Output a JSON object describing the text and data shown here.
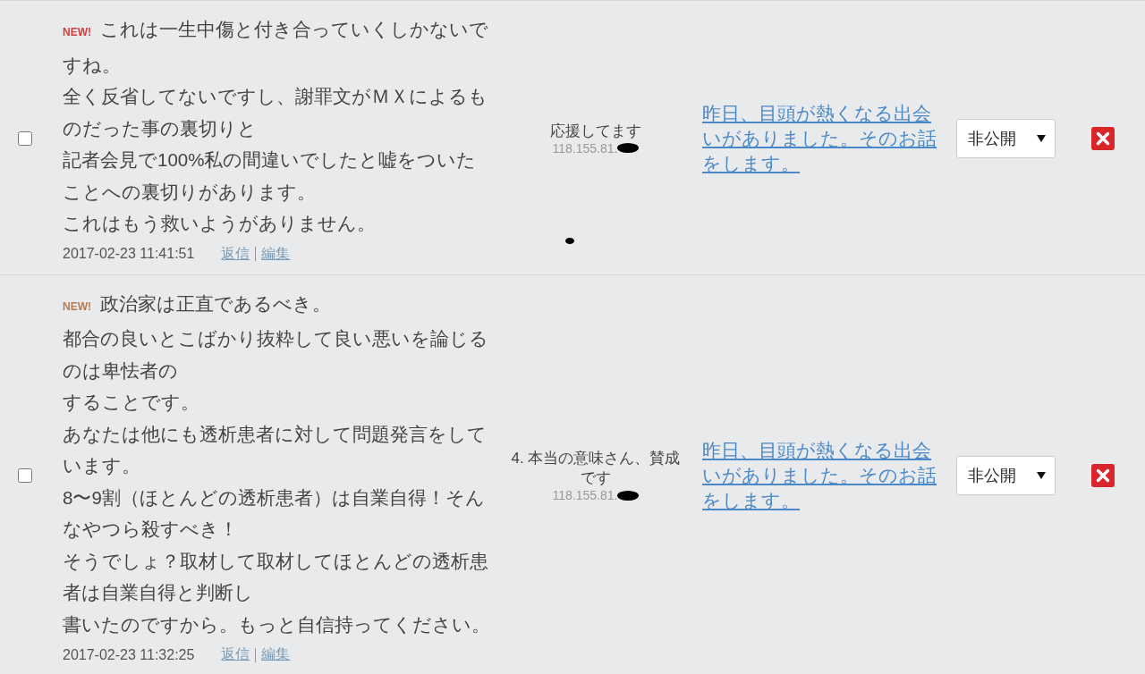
{
  "comments": [
    {
      "checked": false,
      "badge": {
        "label": "NEW!",
        "color": "#d83a3a"
      },
      "lines": [
        "これは一生中傷と付き合っていくしかないで",
        "すね。",
        "全く反省してないですし、謝罪文がＭＸによるも",
        "のだった事の裏切りと",
        "記者会見で100%私の間違いでしたと嘘をついた",
        "ことへの裏切りがあります。",
        "これはもう救いようがありません。"
      ],
      "date": "2017-02-23 11:41:51",
      "actions": [
        "返信",
        "編集"
      ],
      "author": "応援してます",
      "ip": "118.155.81.",
      "post_link": "昨日、目頭が熱くなる出会いがありました。そのお話をします。",
      "visibility": "非公開",
      "stray_mark": true
    },
    {
      "checked": false,
      "badge": {
        "label": "NEW!",
        "color": "#b87a4e"
      },
      "lines": [
        "政治家は正直であるべき。",
        "都合の良いとこばかり抜粋して良い悪いを論じる",
        "のは卑怯者の",
        "することです。",
        "あなたは他にも透析患者に対して問題発言をして",
        "います。",
        "8〜9割（ほとんどの透析患者）は自業自得！そん",
        "なやつら殺すべき！",
        "そうでしょ？取材して取材してほとんどの透析患",
        "者は自業自得と判断し",
        "書いたのですから。もっと自信持ってください。"
      ],
      "date": "2017-02-23 11:32:25",
      "actions": [
        "返信",
        "編集"
      ],
      "author": "4. 本当の意味さん、賛成です",
      "ip": "118.155.81.",
      "post_link": "昨日、目頭が熱くなる出会いがありました。そのお話をします。",
      "visibility": "非公開",
      "stray_mark": false
    }
  ]
}
